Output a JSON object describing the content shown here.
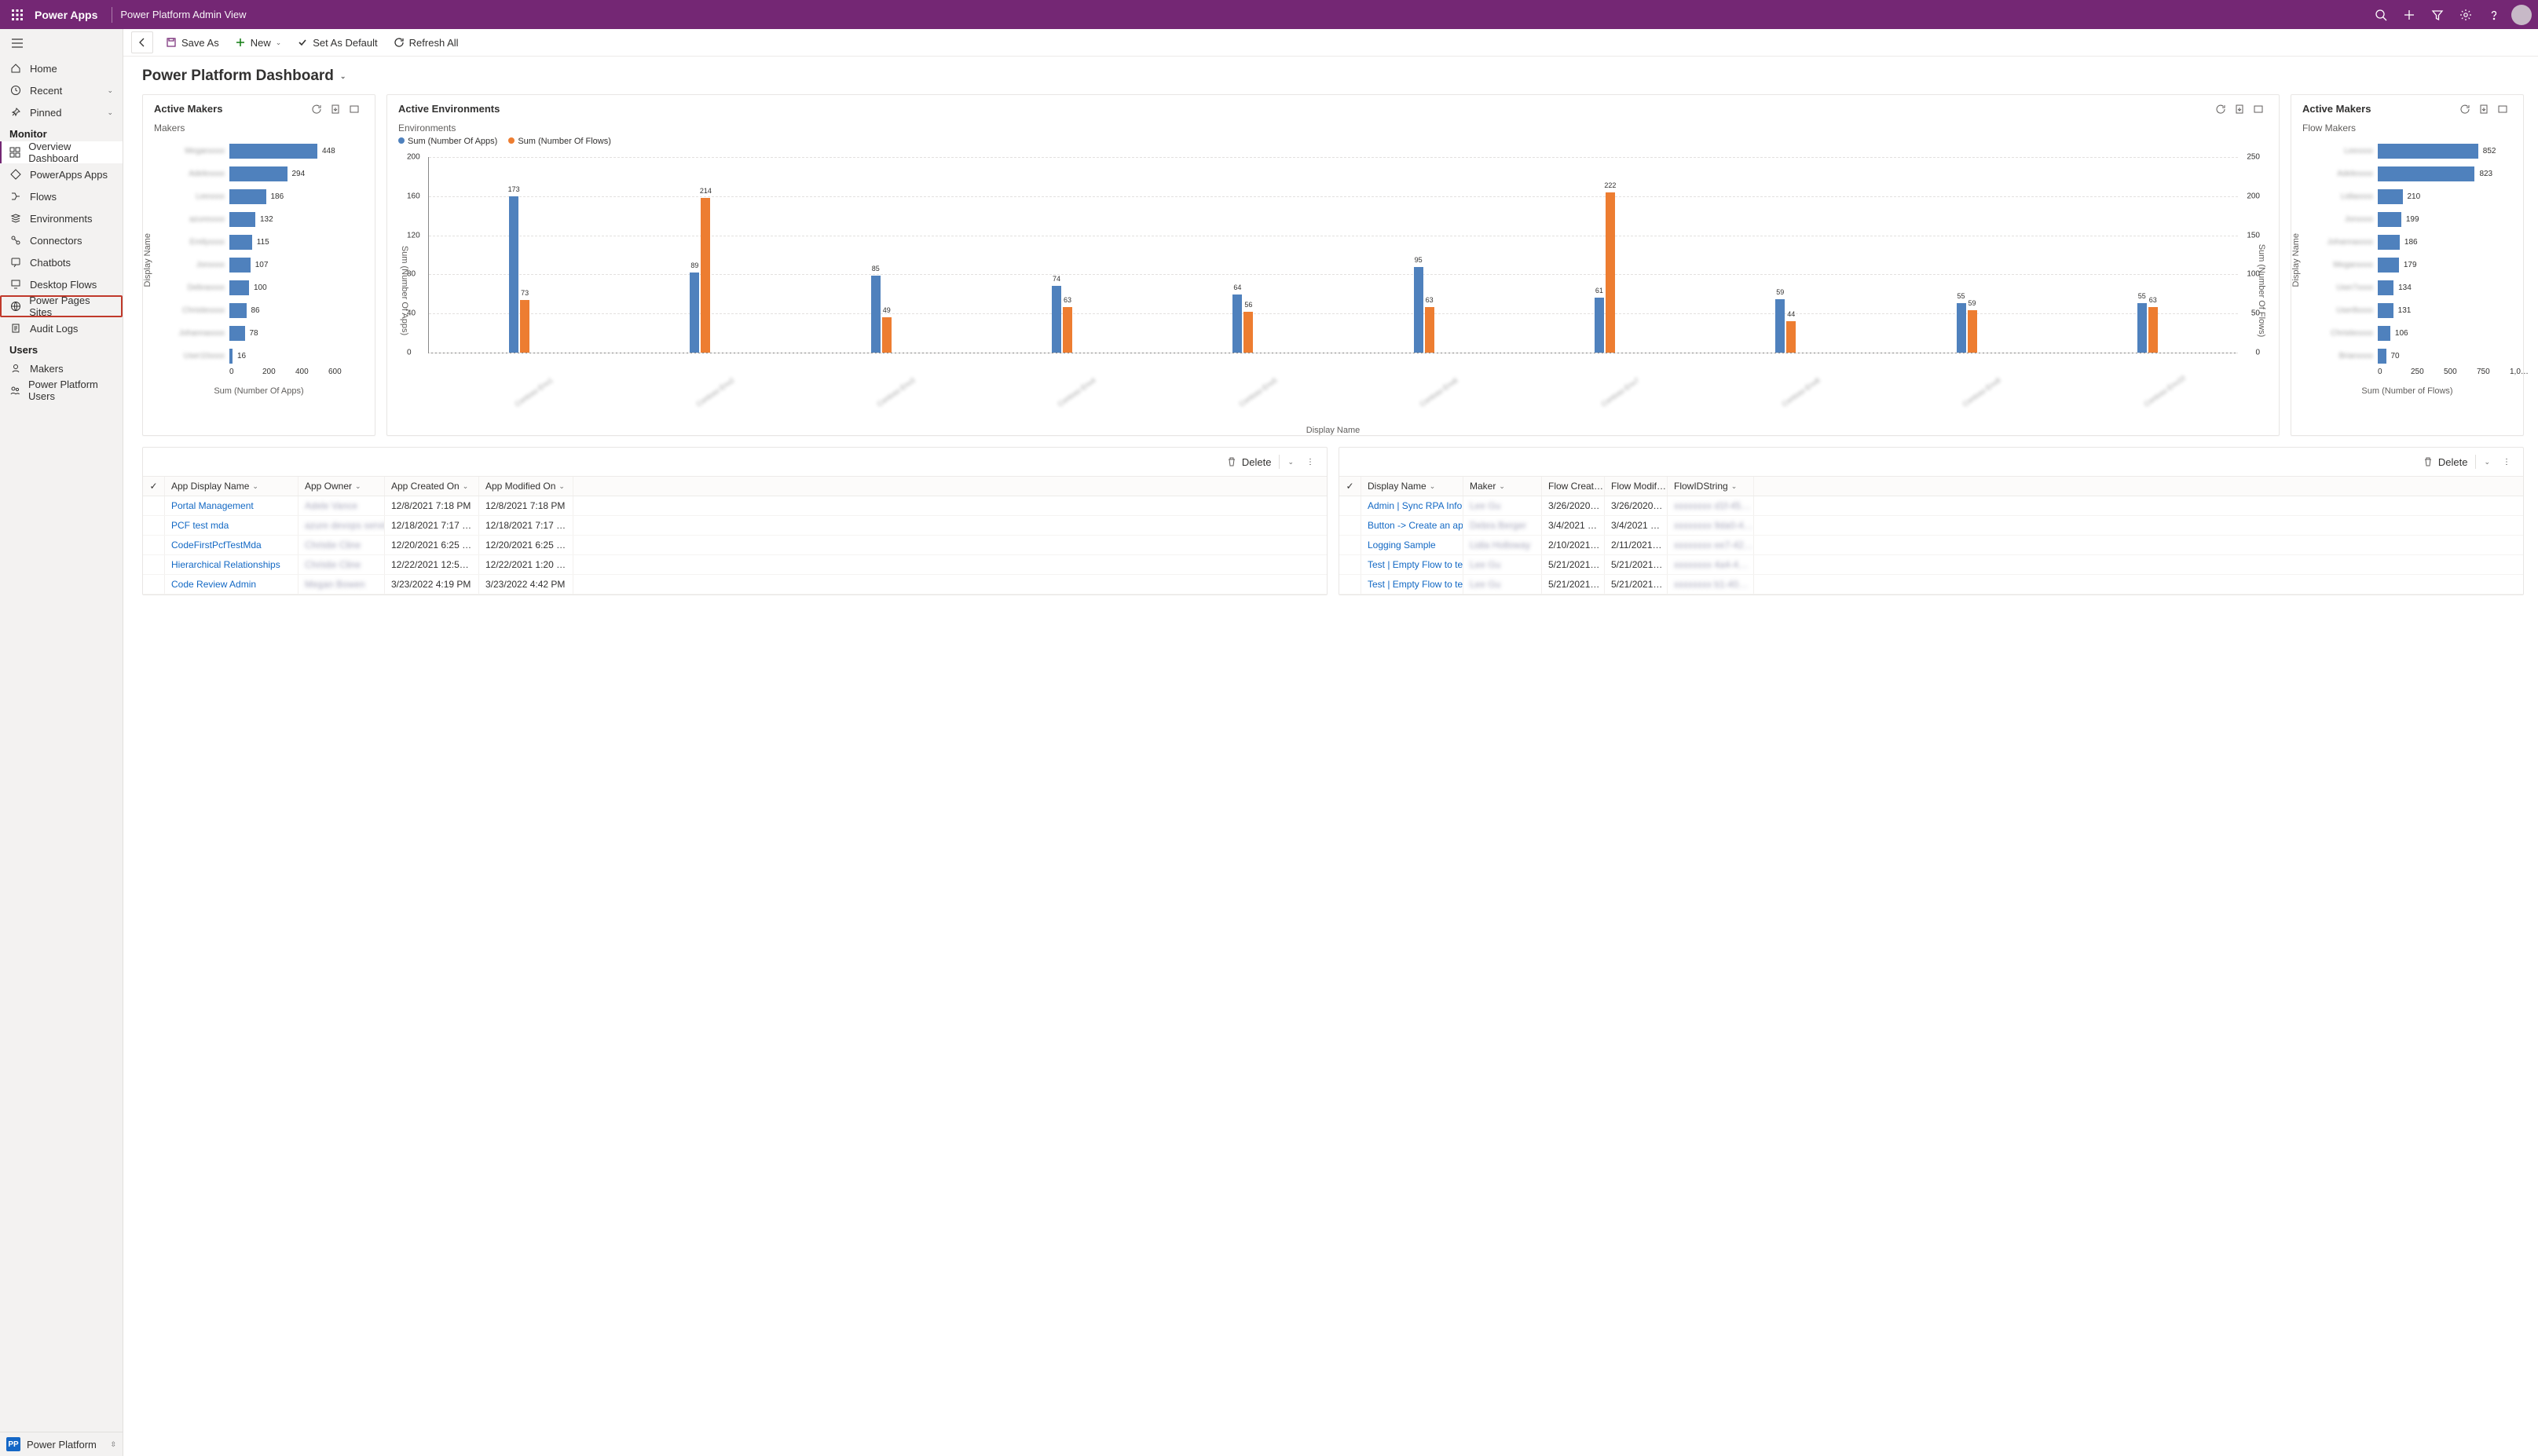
{
  "header": {
    "app_name": "Power Apps",
    "page_title": "Power Platform Admin View"
  },
  "sidebar": {
    "home": "Home",
    "recent": "Recent",
    "pinned": "Pinned",
    "monitor_header": "Monitor",
    "monitor": [
      "Overview Dashboard",
      "PowerApps Apps",
      "Flows",
      "Environments",
      "Connectors",
      "Chatbots",
      "Desktop Flows",
      "Power Pages Sites",
      "Audit Logs"
    ],
    "users_header": "Users",
    "users": [
      "Makers",
      "Power Platform Users"
    ],
    "footer_label": "Power Platform",
    "footer_badge": "PP"
  },
  "commandbar": {
    "save_as": "Save As",
    "new": "New",
    "set_default": "Set As Default",
    "refresh": "Refresh All"
  },
  "dashboard": {
    "title": "Power Platform Dashboard"
  },
  "card1": {
    "title": "Active Makers",
    "subtitle": "Makers",
    "axis_label": "Sum (Number Of Apps)",
    "y_label": "Display Name"
  },
  "card2": {
    "title": "Active Environments",
    "subtitle": "Environments",
    "legend_a": "Sum (Number Of Apps)",
    "legend_b": "Sum (Number Of Flows)",
    "x_label": "Display Name",
    "yl_left": "Sum (Number Of Apps)",
    "yl_right": "Sum (Number Of Flows)"
  },
  "card3": {
    "title": "Active Makers",
    "subtitle": "Flow Makers",
    "axis_label": "Sum (Number of Flows)",
    "y_label": "Display Name"
  },
  "tbl": {
    "delete": "Delete"
  },
  "tbl1": {
    "cols": [
      "App Display Name",
      "App Owner",
      "App Created On",
      "App Modified On"
    ],
    "rows": [
      {
        "name": "Portal Management",
        "owner": "Adele Vance",
        "created": "12/8/2021 7:18 PM",
        "modified": "12/8/2021 7:18 PM"
      },
      {
        "name": "PCF test mda",
        "owner": "azure devops service",
        "created": "12/18/2021 7:17 …",
        "modified": "12/18/2021 7:17 …"
      },
      {
        "name": "CodeFirstPcfTestMda",
        "owner": "Christie Cline",
        "created": "12/20/2021 6:25 …",
        "modified": "12/20/2021 6:25 …"
      },
      {
        "name": "Hierarchical Relationships",
        "owner": "Christie Cline",
        "created": "12/22/2021 12:5…",
        "modified": "12/22/2021 1:20 …"
      },
      {
        "name": "Code Review Admin",
        "owner": "Megan Bowen",
        "created": "3/23/2022 4:19 PM",
        "modified": "3/23/2022 4:42 PM"
      }
    ]
  },
  "tbl2": {
    "cols": [
      "Display Name",
      "Maker",
      "Flow Creat…",
      "Flow Modif…",
      "FlowIDString"
    ],
    "rows": [
      {
        "name": "Admin | Sync RPA Infor",
        "maker": "Lee Gu",
        "created": "3/26/2020…",
        "modified": "3/26/2020…",
        "id": "xxxxxxxx d1f-45…"
      },
      {
        "name": "Button -> Create an ap",
        "maker": "Debra Berger",
        "created": "3/4/2021 …",
        "modified": "3/4/2021 …",
        "id": "xxxxxxxx 9da0-4…"
      },
      {
        "name": "Logging Sample",
        "maker": "Lidia Holloway",
        "created": "2/10/2021…",
        "modified": "2/11/2021…",
        "id": "xxxxxxxx ee7-42…"
      },
      {
        "name": "Test | Empty Flow to tes",
        "maker": "Lee Gu",
        "created": "5/21/2021…",
        "modified": "5/21/2021…",
        "id": "xxxxxxxx 4a4-4…"
      },
      {
        "name": "Test | Empty Flow to tes",
        "maker": "Lee Gu",
        "created": "5/21/2021…",
        "modified": "5/21/2021…",
        "id": "xxxxxxxx b1-40…"
      }
    ]
  },
  "chart_data": [
    {
      "id": "makers_apps",
      "type": "bar",
      "orientation": "horizontal",
      "title": "Active Makers — Makers",
      "ylabel": "Display Name",
      "xlabel": "Sum (Number Of Apps)",
      "xlim": [
        0,
        600
      ],
      "xticks": [
        0,
        200,
        400,
        600
      ],
      "categories": [
        "Megan",
        "Adele",
        "Lee",
        "azure",
        "Emily",
        "Jon",
        "Debra",
        "Christie",
        "Johanna",
        "User10"
      ],
      "values": [
        448,
        294,
        186,
        132,
        115,
        107,
        100,
        86,
        78,
        16
      ]
    },
    {
      "id": "environments",
      "type": "bar",
      "orientation": "vertical",
      "title": "Active Environments — Environments",
      "xlabel": "Display Name",
      "ylabel_left": "Sum (Number Of Apps)",
      "ylabel_right": "Sum (Number Of Flows)",
      "ylim_left": [
        0,
        200
      ],
      "ylim_right": [
        0,
        250
      ],
      "yticks_left": [
        0,
        40,
        80,
        120,
        160,
        200
      ],
      "yticks_right": [
        0,
        50,
        100,
        150,
        200,
        250
      ],
      "categories": [
        "Env1",
        "Env2",
        "Env3",
        "Env4",
        "Env5",
        "Env6",
        "Env7",
        "Env8",
        "Env9",
        "Env10"
      ],
      "series": [
        {
          "name": "Sum (Number Of Apps)",
          "axis": "left",
          "values": [
            173,
            89,
            85,
            74,
            64,
            95,
            61,
            59,
            55,
            55
          ]
        },
        {
          "name": "Sum (Number Of Flows)",
          "axis": "right",
          "values": [
            73,
            214,
            49,
            63,
            56,
            63,
            222,
            44,
            59,
            63
          ]
        }
      ]
    },
    {
      "id": "flow_makers",
      "type": "bar",
      "orientation": "horizontal",
      "title": "Active Makers — Flow Makers",
      "ylabel": "Display Name",
      "xlabel": "Sum (Number of Flows)",
      "xlim": [
        0,
        1000
      ],
      "xticks": [
        0,
        250,
        500,
        750,
        "1,0…"
      ],
      "categories": [
        "Lee",
        "Adele",
        "Lidia",
        "Jon",
        "Johanna",
        "Megan",
        "User7",
        "User8",
        "Christie",
        "Brian"
      ],
      "values": [
        852,
        823,
        210,
        199,
        186,
        179,
        134,
        131,
        106,
        70
      ]
    }
  ]
}
